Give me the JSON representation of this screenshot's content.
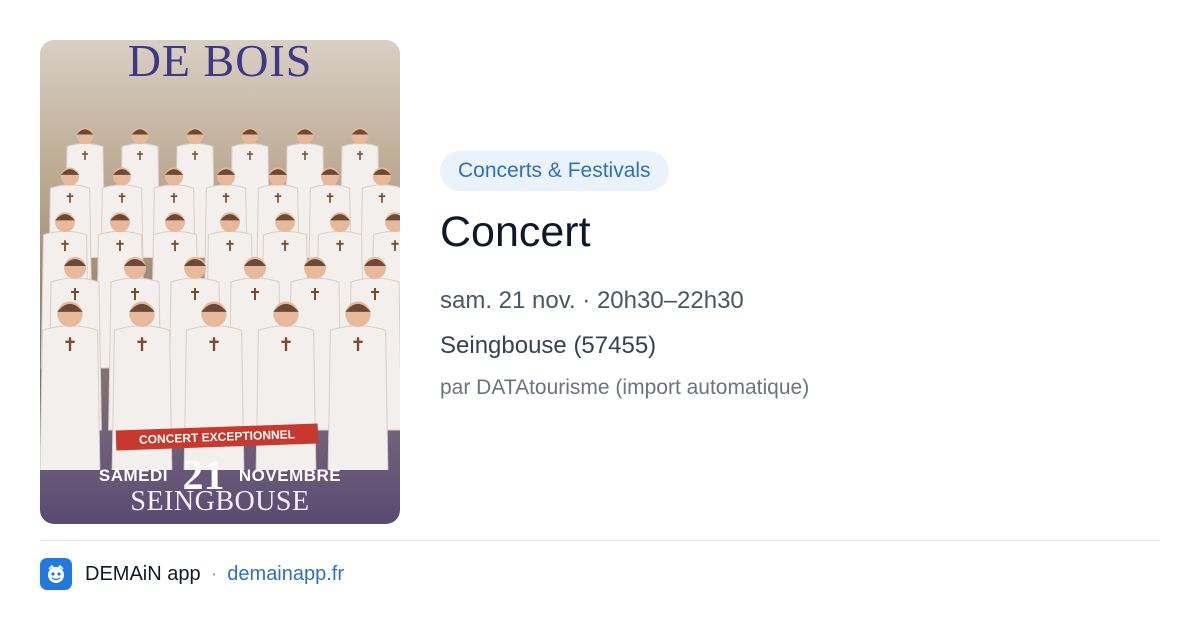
{
  "poster": {
    "title_fragment": "DE BOIS",
    "banner": "CONCERT EXCEPTIONNEL",
    "day_label": "SAMEDI",
    "day_number": "21",
    "month_label": "NOVEMBRE",
    "city": "SEINGBOUSE"
  },
  "event": {
    "category": "Concerts & Festivals",
    "title": "Concert",
    "datetime": "sam. 21 nov. · 20h30–22h30",
    "location": "Seingbouse (57455)",
    "source": "par DATAtourisme (import automatique)"
  },
  "footer": {
    "app_name": "DEMAiN app",
    "separator": "·",
    "link": "demainapp.fr",
    "icon": "demain-app-icon"
  },
  "colors": {
    "accent": "#2f6fc4",
    "category_bg": "#eaf2fb",
    "poster_banner": "#c8382c"
  }
}
